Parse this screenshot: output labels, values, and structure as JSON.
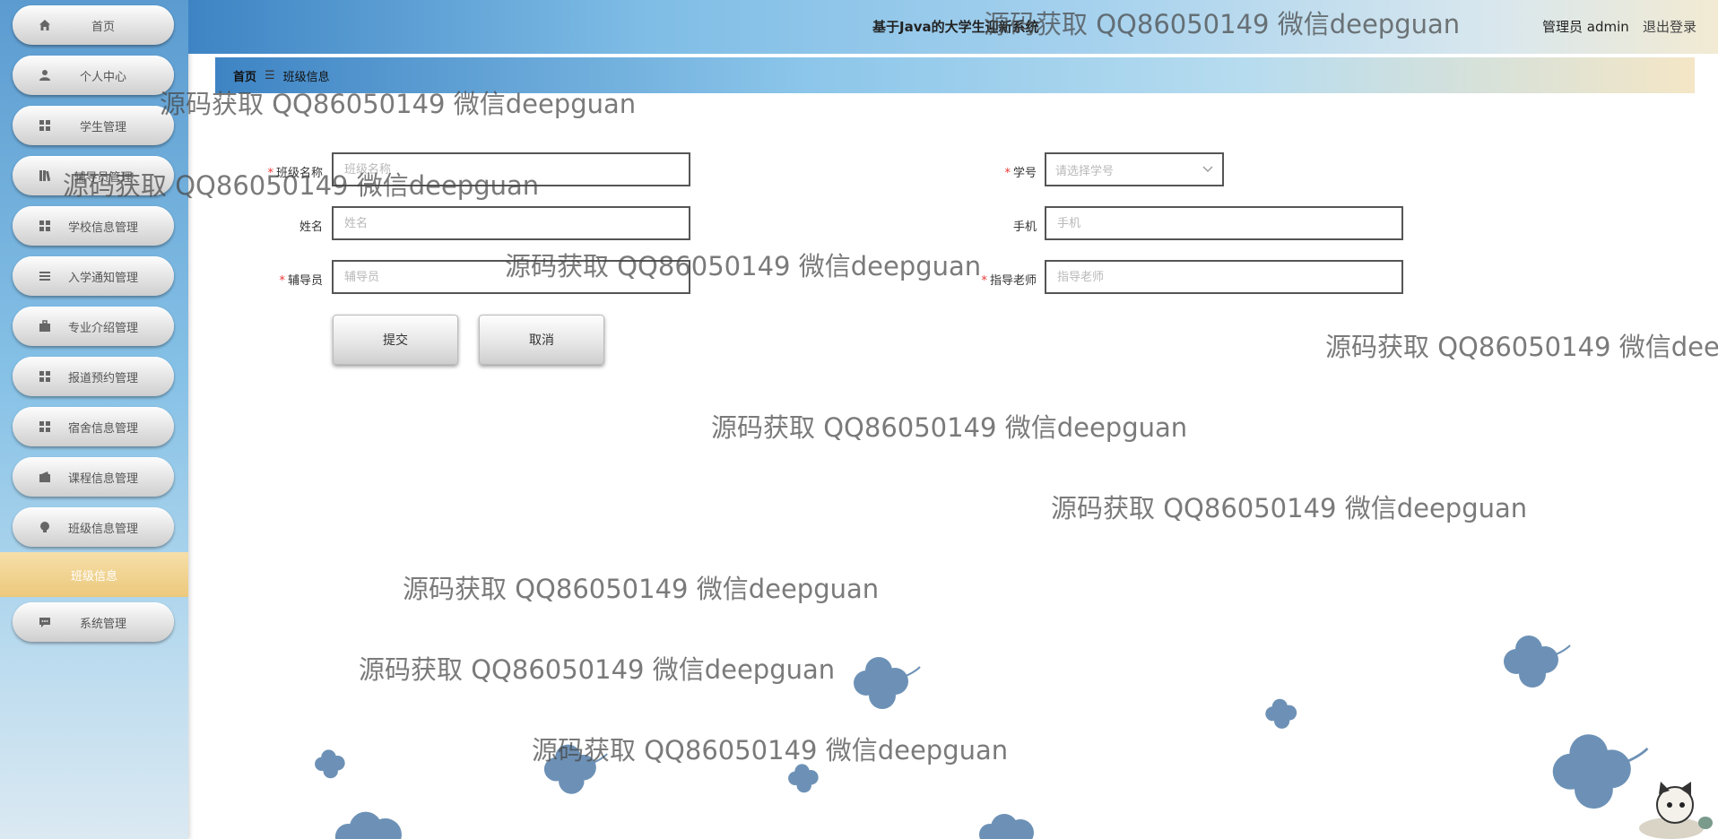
{
  "header": {
    "title": "基于Java的大学生迎新系统",
    "user": "管理员 admin",
    "logout": "退出登录"
  },
  "sidebar": {
    "items": [
      {
        "label": "首页",
        "icon": "home-icon"
      },
      {
        "label": "个人中心",
        "icon": "user-icon"
      },
      {
        "label": "学生管理",
        "icon": "grid-icon"
      },
      {
        "label": "辅导员管理",
        "icon": "book-icon"
      },
      {
        "label": "学校信息管理",
        "icon": "grid-icon"
      },
      {
        "label": "入学通知管理",
        "icon": "list-icon"
      },
      {
        "label": "专业介绍管理",
        "icon": "briefcase-icon"
      },
      {
        "label": "报道预约管理",
        "icon": "grid-icon"
      },
      {
        "label": "宿舍信息管理",
        "icon": "grid-icon"
      },
      {
        "label": "课程信息管理",
        "icon": "wallet-icon"
      },
      {
        "label": "班级信息管理",
        "icon": "bulb-icon"
      }
    ],
    "sub_item": "班级信息",
    "last_item": {
      "label": "系统管理",
      "icon": "chat-icon"
    }
  },
  "breadcrumb": {
    "home": "首页",
    "separator": "☰",
    "current": "班级信息"
  },
  "form": {
    "class_name": {
      "label": "班级名称",
      "placeholder": "班级名称",
      "required": true
    },
    "student_id": {
      "label": "学号",
      "placeholder": "请选择学号",
      "required": true
    },
    "name": {
      "label": "姓名",
      "placeholder": "姓名",
      "required": false
    },
    "phone": {
      "label": "手机",
      "placeholder": "手机",
      "required": false
    },
    "counselor": {
      "label": "辅导员",
      "placeholder": "辅导员",
      "required": true
    },
    "advisor": {
      "label": "指导老师",
      "placeholder": "指导老师",
      "required": true
    },
    "submit_label": "提交",
    "cancel_label": "取消"
  },
  "watermark": "源码获取 QQ86050149 微信deepguan",
  "colors": {
    "flower": "#6d91b6",
    "required": "#ee3333"
  }
}
